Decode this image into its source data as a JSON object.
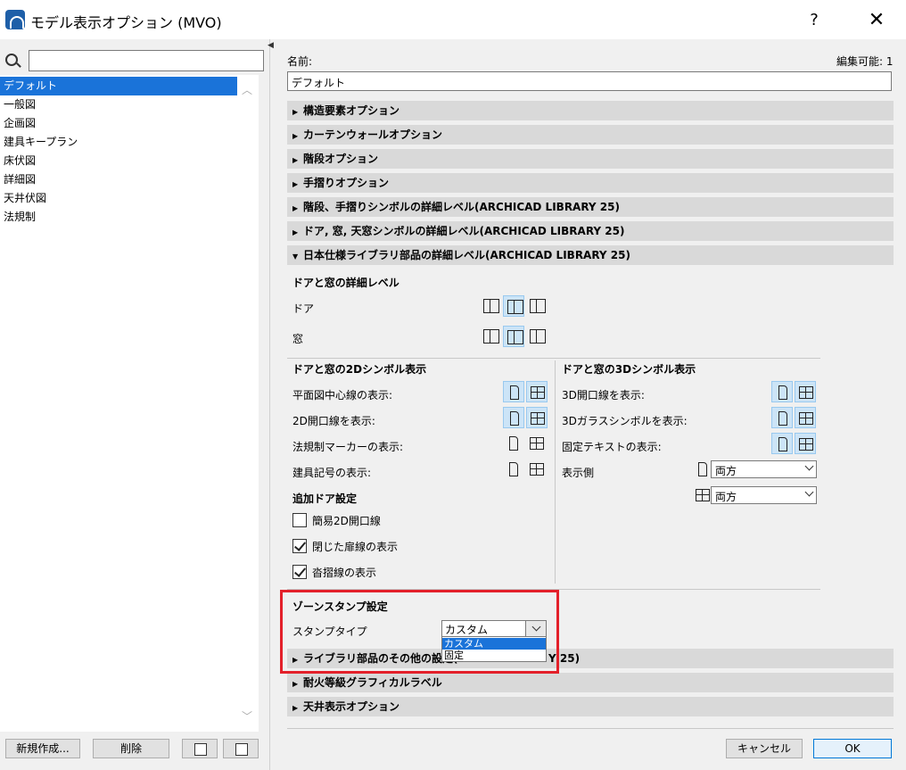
{
  "window": {
    "title": "モデル表示オプション (MVO)",
    "help": "?",
    "close": "✕"
  },
  "left": {
    "search_placeholder": "",
    "items": [
      "デフォルト",
      "一般図",
      "企画図",
      "建具キープラン",
      "床伏図",
      "詳細図",
      "天井伏図",
      "法規制"
    ],
    "selected_index": 0,
    "buttons": {
      "new": "新規作成...",
      "delete": "削除"
    }
  },
  "right": {
    "name_label": "名前:",
    "edit_label": "編集可能: 1",
    "name_value": "デフォルト",
    "sections_top": [
      "構造要素オプション",
      "カーテンウォールオプション",
      "階段オプション",
      "手摺りオプション",
      "階段、手摺りシンボルの詳細レベル(ARCHICAD LIBRARY 25)",
      "ドア, 窓, 天窓シンボルの詳細レベル(ARCHICAD LIBRARY 25)",
      "日本仕様ライブラリ部品の詳細レベル(ARCHICAD LIBRARY 25)"
    ],
    "detail": {
      "level_title": "ドアと窓の詳細レベル",
      "door_label": "ドア",
      "window_label": "窓",
      "sym2d_title": "ドアと窓の2Dシンボル表示",
      "sym2d_rows": [
        "平面図中心線の表示:",
        "2D開口線を表示:",
        "法規制マーカーの表示:",
        "建具記号の表示:"
      ],
      "sym3d_title": "ドアと窓の3Dシンボル表示",
      "sym3d_rows": [
        "3D開口線を表示:",
        "3Dガラスシンボルを表示:",
        "固定テキストの表示:"
      ],
      "display_side_label": "表示側",
      "display_side_door": "両方",
      "display_side_window": "両方",
      "extra_door_title": "追加ドア設定",
      "checkboxes": [
        {
          "label": "簡易2D開口線",
          "checked": false
        },
        {
          "label": "閉じた扉線の表示",
          "checked": true
        },
        {
          "label": "沓摺線の表示",
          "checked": true
        }
      ],
      "zone_title": "ゾーンスタンプ設定",
      "stamp_type_label": "スタンプタイプ",
      "stamp_type_value": "カスタム",
      "stamp_options": [
        "カスタム",
        "固定"
      ],
      "highlight_color": "#e3202a"
    },
    "sections_bottom": [
      {
        "visible_start": "ライブラリ部品のその他の設定(",
        "visible_end": "Y 25)"
      },
      {
        "label": "耐火等級グラフィカルラベル"
      },
      {
        "label": "天井表示オプション"
      }
    ],
    "buttons": {
      "cancel": "キャンセル",
      "ok": "OK"
    }
  }
}
